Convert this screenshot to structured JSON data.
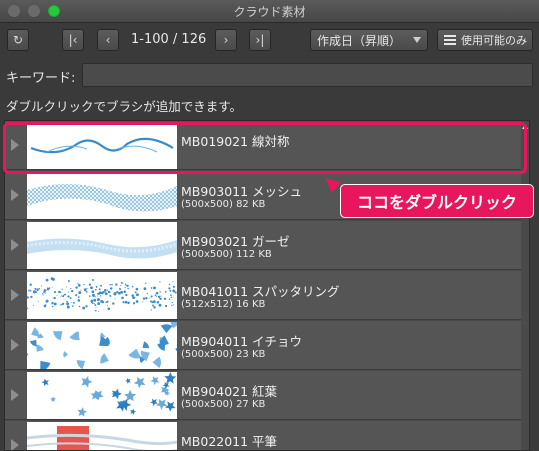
{
  "window": {
    "title": "クラウド素材"
  },
  "toolbar": {
    "pager_text": "1-100 / 126",
    "sort_label": "作成日（昇順）",
    "usable_label": "使用可能のみ",
    "refresh_icon": "refresh-icon",
    "first_icon": "first-page-icon",
    "prev_icon": "previous-page-icon",
    "next_icon": "next-page-icon",
    "last_icon": "last-page-icon"
  },
  "search": {
    "label": "キーワード:",
    "value": "",
    "placeholder": ""
  },
  "hint": "ダブルクリックでブラシが追加できます。",
  "items": [
    {
      "name": "MB019021 線対称",
      "meta": ""
    },
    {
      "name": "MB903011 メッシュ",
      "meta": "(500x500) 82 KB"
    },
    {
      "name": "MB903021 ガーゼ",
      "meta": "(500x500) 112 KB"
    },
    {
      "name": "MB041011 スパッタリング",
      "meta": "(512x512) 16 KB"
    },
    {
      "name": "MB904011 イチョウ",
      "meta": "(500x500) 23 KB"
    },
    {
      "name": "MB904021 紅葉",
      "meta": "(500x500) 27 KB"
    },
    {
      "name": "MB022011 平筆",
      "meta": ""
    }
  ],
  "annotation": {
    "text": "ココをダブルクリック",
    "color": "#e8175d"
  }
}
